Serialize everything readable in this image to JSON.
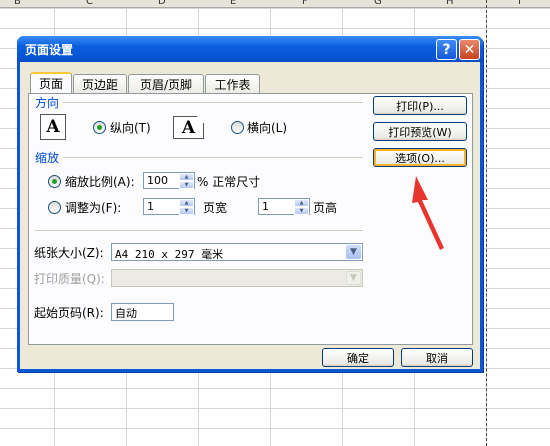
{
  "sheet": {
    "column_headers": [
      "B",
      "C",
      "D",
      "E",
      "F",
      "G",
      "H",
      "I"
    ]
  },
  "dialog": {
    "title": "页面设置",
    "help_glyph": "?",
    "close_glyph": "✕",
    "tabs": [
      {
        "label": "页面",
        "active": true
      },
      {
        "label": "页边距",
        "active": false
      },
      {
        "label": "页眉/页脚",
        "active": false
      },
      {
        "label": "工作表",
        "active": false
      }
    ],
    "orientation": {
      "group_label": "方向",
      "page_glyph": "A",
      "portrait_label": "纵向(T)",
      "landscape_label": "横向(L)",
      "selected": "portrait"
    },
    "scaling": {
      "group_label": "缩放",
      "zoom_label": "缩放比例(A):",
      "zoom_value": "100",
      "zoom_suffix": "% 正常尺寸",
      "fit_label": "调整为(F):",
      "pages_wide_value": "1",
      "pages_wide_label": "页宽",
      "pages_tall_value": "1",
      "pages_tall_label": "页高",
      "selected": "zoom"
    },
    "paper_size": {
      "label": "纸张大小(Z):",
      "value": "A4 210 x 297 毫米"
    },
    "print_quality": {
      "label": "打印质量(Q):",
      "value": ""
    },
    "first_page": {
      "label": "起始页码(R):",
      "value": "自动"
    },
    "side_buttons": {
      "print": "打印(P)...",
      "print_preview": "打印预览(W)",
      "options": "选项(O)..."
    },
    "footer_buttons": {
      "ok": "确定",
      "cancel": "取消"
    }
  },
  "colors": {
    "titlebar": "#0a5fe0",
    "group_label": "#0046d5",
    "annotation_arrow": "#e8362f",
    "focus_ring": "#f8b330"
  }
}
